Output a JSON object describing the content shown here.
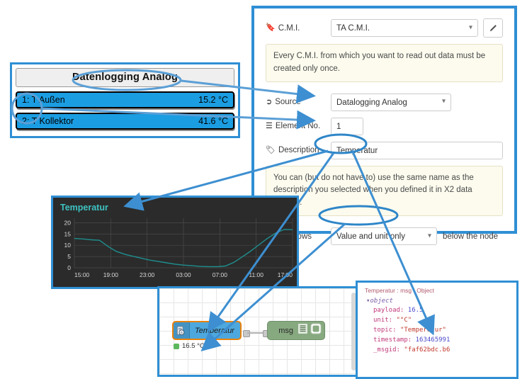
{
  "datalogging_panel": {
    "header": "Datenlogging Analog",
    "rows": [
      {
        "label": "1: T Außen",
        "value": "15.2 °C"
      },
      {
        "label": "2: T Kollektor",
        "value": "41.6 °C"
      }
    ]
  },
  "form": {
    "cmi": {
      "label": "C.M.I.",
      "icon": "bookmark-icon",
      "value": "TA C.M.I.",
      "edit_icon": "pencil-icon",
      "note": "Every C.M.I. from which you want to read out data must be created only once."
    },
    "source": {
      "label": "Source",
      "icon": "export-icon",
      "value": "Datalogging Analog"
    },
    "element_no": {
      "label": "Element No.",
      "icon": "list-icon",
      "value": "1"
    },
    "description": {
      "label": "Description",
      "icon": "tag-icon",
      "value": "Temperatur",
      "note": "You can (but do not have to) use the same name as the description you selected when you defined it in X2 data logging."
    },
    "ui_shows": {
      "label": "UI shows",
      "icon": "calendar-icon",
      "value": "Value and unit only",
      "trailing": "below the node"
    }
  },
  "chart_data": {
    "type": "line",
    "title": "Temperatur",
    "xlabel": "",
    "ylabel": "",
    "ylim": [
      0,
      22
    ],
    "yticks": [
      0,
      5,
      10,
      15,
      20
    ],
    "xticks": [
      "15:00",
      "19:00",
      "23:00",
      "03:00",
      "07:00",
      "11:00",
      "17:00"
    ],
    "grid": true,
    "legend": "none",
    "series": [
      {
        "name": "Temperatur",
        "color": "#1f8f8f",
        "x": [
          "15:30",
          "16:30",
          "17:30",
          "18:00",
          "19:00",
          "20:00",
          "21:00",
          "22:00",
          "23:00",
          "00:00",
          "01:00",
          "02:00",
          "03:00",
          "04:00",
          "05:00",
          "06:00",
          "07:00",
          "08:00",
          "09:00",
          "10:00",
          "11:00",
          "12:00",
          "13:00",
          "14:00",
          "15:00",
          "16:00",
          "16:30"
        ],
        "values": [
          13,
          12.8,
          12.4,
          12.2,
          9.5,
          7.3,
          6,
          5.1,
          4.2,
          3.4,
          2.8,
          2.2,
          1.6,
          1.2,
          0.9,
          0.6,
          0.5,
          0.5,
          0.8,
          2.4,
          4.8,
          7.4,
          10.2,
          13,
          15.4,
          17,
          16.9
        ]
      }
    ]
  },
  "flow": {
    "input_node": {
      "label": "Temperatur",
      "icon": "cmi-icon",
      "status": "16.5 °C",
      "status_icon": "green-square-icon"
    },
    "debug_node": {
      "label": "msg",
      "icon": "debug-lines-icon",
      "toggle_icon": "debug-toggle-icon"
    }
  },
  "debug": {
    "header": "Temperatur : msg : Object",
    "root": "object",
    "entries": [
      {
        "key": "payload:",
        "value": "16.5",
        "type": "num"
      },
      {
        "key": "unit:",
        "value": "\"°C\"",
        "type": "str"
      },
      {
        "key": "topic:",
        "value": "\"Temperatur\"",
        "type": "str"
      },
      {
        "key": "timestamp:",
        "value": "163465991",
        "type": "num"
      },
      {
        "key": "_msgid:",
        "value": "\"faf62bdc.b6",
        "type": "str"
      }
    ]
  },
  "colors": {
    "callout_blue": "#2f8fd4",
    "row_blue": "#1b9de2",
    "chart_line": "#1f8f8f",
    "chart_title": "#3fc2c2",
    "node_orange": "#e8820c"
  }
}
